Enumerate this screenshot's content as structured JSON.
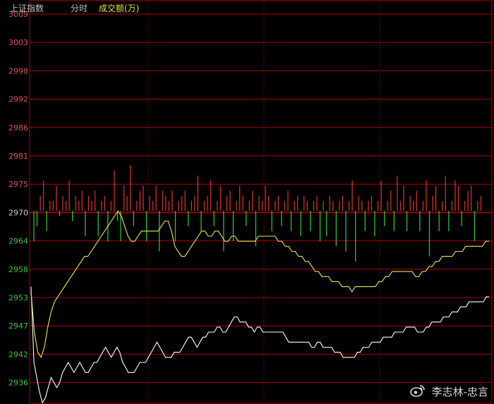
{
  "header": {
    "index_name": "上证指数",
    "mode": "分时",
    "volume_label": "成交额(万)"
  },
  "watermark": {
    "text": "李志林-忠言",
    "icon": "weibo-icon"
  },
  "colors": {
    "background": "#000000",
    "grid": "#b00000",
    "axis_text_up": "#e05050",
    "axis_text_down": "#40c040",
    "axis_text_base": "#c8c8c8",
    "price_line": "#ffffff",
    "avg_line": "#e8e850",
    "bar_up": "#d03030",
    "bar_down": "#30c030",
    "header_text": "#c0c0c0",
    "header_volume": "#e0e040"
  },
  "chart_data": {
    "type": "line",
    "base_price": 2970,
    "ylim": [
      2931,
      3009
    ],
    "y_ticks": [
      3009,
      3003,
      2998,
      2992,
      2986,
      2981,
      2975,
      2970,
      2964,
      2958,
      2953,
      2947,
      2942,
      2936
    ],
    "x_points": 240,
    "series": [
      {
        "role": "price",
        "color": "#ffffff",
        "values": [
          2955,
          2940,
          2937,
          2934,
          2932,
          2933,
          2935,
          2937,
          2936,
          2935,
          2936,
          2938,
          2939,
          2940,
          2939,
          2938,
          2939,
          2940,
          2939,
          2938,
          2938,
          2939,
          2940,
          2940,
          2941,
          2942,
          2943,
          2942,
          2941,
          2942,
          2943,
          2942,
          2940,
          2939,
          2938,
          2938,
          2938,
          2939,
          2940,
          2940,
          2940,
          2941,
          2942,
          2943,
          2944,
          2943,
          2942,
          2941,
          2941,
          2941,
          2942,
          2942,
          2942,
          2943,
          2944,
          2945,
          2945,
          2944,
          2943,
          2944,
          2945,
          2945,
          2946,
          2946,
          2946,
          2947,
          2947,
          2946,
          2946,
          2947,
          2948,
          2949,
          2949,
          2948,
          2948,
          2948,
          2947,
          2947,
          2946,
          2947,
          2947,
          2946,
          2946,
          2946,
          2946,
          2946,
          2946,
          2946,
          2946,
          2945,
          2944,
          2944,
          2944,
          2944,
          2944,
          2944,
          2944,
          2944,
          2943,
          2943,
          2944,
          2944,
          2943,
          2943,
          2943,
          2943,
          2942,
          2942,
          2942,
          2941,
          2941,
          2941,
          2941,
          2941,
          2942,
          2942,
          2943,
          2943,
          2943,
          2944,
          2944,
          2944,
          2944,
          2945,
          2945,
          2945,
          2945,
          2946,
          2946,
          2946,
          2946,
          2947,
          2947,
          2947,
          2947,
          2946,
          2946,
          2946,
          2947,
          2947,
          2948,
          2948,
          2948,
          2948,
          2949,
          2949,
          2949,
          2950,
          2950,
          2950,
          2951,
          2951,
          2951,
          2952,
          2952,
          2952,
          2952,
          2952,
          2952,
          2953,
          2953
        ]
      },
      {
        "role": "average",
        "color": "#e8e850",
        "values": [
          2954,
          2946,
          2942,
          2941,
          2943,
          2947,
          2950,
          2952,
          2953,
          2954,
          2955,
          2956,
          2957,
          2958,
          2959,
          2960,
          2961,
          2961,
          2962,
          2963,
          2964,
          2965,
          2966,
          2967,
          2968,
          2969,
          2970,
          2969,
          2967,
          2965,
          2964,
          2964,
          2965,
          2966,
          2966,
          2966,
          2966,
          2966,
          2966,
          2967,
          2968,
          2968,
          2966,
          2963,
          2962,
          2961,
          2961,
          2962,
          2963,
          2964,
          2965,
          2966,
          2966,
          2965,
          2965,
          2966,
          2966,
          2965,
          2964,
          2964,
          2965,
          2965,
          2964,
          2964,
          2964,
          2964,
          2964,
          2964,
          2965,
          2965,
          2965,
          2965,
          2965,
          2965,
          2964,
          2964,
          2963,
          2963,
          2962,
          2962,
          2961,
          2961,
          2960,
          2960,
          2959,
          2958,
          2958,
          2957,
          2957,
          2957,
          2956,
          2956,
          2956,
          2955,
          2955,
          2955,
          2954,
          2955,
          2955,
          2955,
          2955,
          2955,
          2955,
          2955,
          2956,
          2956,
          2957,
          2957,
          2958,
          2958,
          2958,
          2958,
          2958,
          2958,
          2958,
          2957,
          2957,
          2958,
          2958,
          2959,
          2959,
          2960,
          2960,
          2961,
          2961,
          2961,
          2961,
          2962,
          2962,
          2962,
          2963,
          2963,
          2963,
          2963,
          2963,
          2963,
          2964,
          2964
        ]
      }
    ],
    "volume": {
      "note": "bar heights relative to base line, positive = up (red), negative = down (green), in chart price units",
      "values": [
        -6,
        -3,
        3,
        6,
        -4,
        2,
        2,
        5,
        -1,
        3,
        2,
        6,
        -2,
        3,
        2,
        4,
        -5,
        3,
        2,
        4,
        -5,
        2,
        3,
        -6,
        2,
        8,
        -2,
        -6,
        5,
        3,
        9,
        -3,
        2,
        4,
        5,
        -6,
        3,
        2,
        5,
        -8,
        4,
        3,
        2,
        4,
        -6,
        2,
        3,
        4,
        -3,
        2,
        3,
        7,
        -4,
        2,
        3,
        6,
        -3,
        2,
        5,
        -8,
        3,
        4,
        -6,
        2,
        5,
        3,
        -3,
        2,
        4,
        -7,
        3,
        2,
        5,
        3,
        -4,
        2,
        3,
        -3,
        2,
        4,
        -4,
        2,
        3,
        -5,
        3,
        2,
        -4,
        2,
        3,
        -6,
        2,
        -5,
        3,
        2,
        -7,
        2,
        3,
        -8,
        2,
        6,
        -10,
        3,
        2,
        -4,
        2,
        3,
        -5,
        2,
        6,
        -3,
        2,
        4,
        -4,
        7,
        2,
        5,
        -4,
        3,
        2,
        4,
        -4,
        2,
        6,
        -9,
        3,
        5,
        -4,
        2,
        7,
        -4,
        2,
        6,
        5,
        -3,
        2,
        4,
        5,
        -6,
        2,
        3
      ]
    }
  }
}
